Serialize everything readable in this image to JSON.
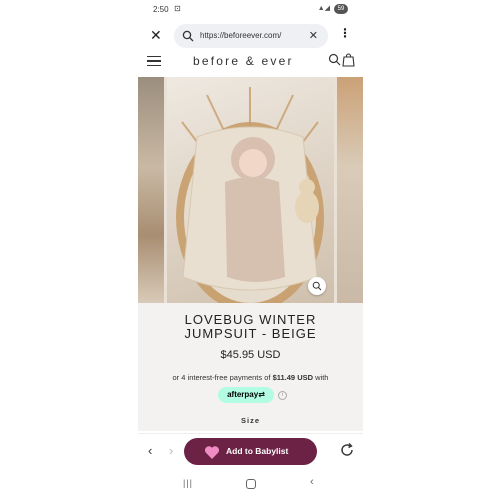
{
  "status_bar": {
    "time": "2:50",
    "battery": "59"
  },
  "browser": {
    "url": "https://beforeever.com/"
  },
  "site": {
    "brand": "before & ever"
  },
  "product": {
    "title_line1": "LOVEBUG WINTER",
    "title_line2": "JUMPSUIT - BEIGE",
    "price": "$45.95 USD",
    "afterpay_text_pre": "or 4 interest-free payments of",
    "afterpay_amount": "$11.49 USD",
    "afterpay_text_post": "with",
    "afterpay_badge": "afterpay",
    "size_label": "Size"
  },
  "bottom_bar": {
    "babylist_label": "Add to Babylist"
  },
  "icons": {
    "close": "close-icon",
    "search": "search-icon",
    "clear": "clear-icon",
    "more": "more-vert-icon",
    "menu": "menu-icon",
    "bag": "bag-icon",
    "zoom": "zoom-icon",
    "heart": "heart-icon",
    "reload": "reload-icon"
  },
  "colors": {
    "babylist_button": "#6b2245",
    "afterpay_badge": "#b2fce4",
    "info_background": "#f4f2f1",
    "url_bar": "#eef0f4"
  }
}
